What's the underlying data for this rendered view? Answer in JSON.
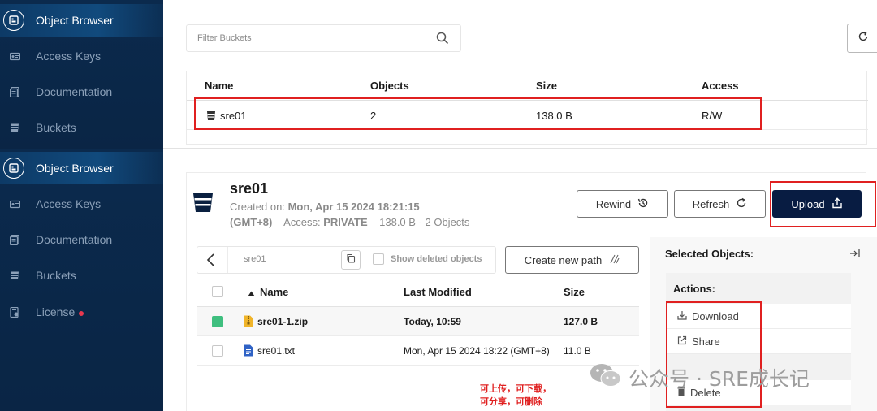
{
  "sidebar_top": {
    "items": [
      {
        "label": "Object Browser",
        "icon": "object-browser-icon",
        "active": true
      },
      {
        "label": "Access Keys",
        "icon": "access-keys-icon"
      },
      {
        "label": "Documentation",
        "icon": "documentation-icon"
      },
      {
        "label": "Buckets",
        "icon": "bucket-icon"
      }
    ]
  },
  "sidebar_bottom": {
    "items": [
      {
        "label": "Object Browser",
        "icon": "object-browser-icon",
        "active": true
      },
      {
        "label": "Access Keys",
        "icon": "access-keys-icon"
      },
      {
        "label": "Documentation",
        "icon": "documentation-icon"
      },
      {
        "label": "Buckets",
        "icon": "bucket-icon"
      },
      {
        "label": "License",
        "icon": "license-icon",
        "badge": "red-dot"
      }
    ]
  },
  "bucket_list": {
    "filter_placeholder": "Filter Buckets",
    "columns": [
      "Name",
      "Objects",
      "Size",
      "Access"
    ],
    "rows": [
      {
        "name": "sre01",
        "objects": "2",
        "size": "138.0 B",
        "access": "R/W"
      }
    ]
  },
  "bucket_detail": {
    "name": "sre01",
    "created_label": "Created on:",
    "created_value": "Mon, Apr 15 2024 18:21:15",
    "timezone": "(GMT+8)",
    "access_label": "Access:",
    "access_value": "PRIVATE",
    "summary": "138.0 B - 2 Objects",
    "buttons": {
      "rewind": "Rewind",
      "refresh": "Refresh",
      "upload": "Upload"
    }
  },
  "browser": {
    "path": "sre01",
    "show_deleted_label": "Show deleted objects",
    "create_path_label": "Create new path",
    "columns": [
      "Name",
      "Last Modified",
      "Size"
    ],
    "rows": [
      {
        "name": "sre01-1.zip",
        "modified": "Today, 10:59",
        "size": "127.0 B",
        "selected": true,
        "icon": "zip-file-icon"
      },
      {
        "name": "sre01.txt",
        "modified": "Mon, Apr 15 2024 18:22 (GMT+8)",
        "size": "11.0 B",
        "selected": false,
        "icon": "text-file-icon"
      }
    ]
  },
  "selected_panel": {
    "title": "Selected Objects:",
    "actions_title": "Actions:",
    "actions": [
      "Download",
      "Share",
      "Delete"
    ]
  },
  "annotation": {
    "line1": "可上传，可下载，",
    "line2": "可分享，可删除"
  },
  "watermark": "公众号 · SRE成长记",
  "colors": {
    "sidebar": "#0b2a4d",
    "upload_button": "#081c42",
    "annotation_red": "#e02020",
    "selected_checkbox": "#3fbf7f"
  }
}
